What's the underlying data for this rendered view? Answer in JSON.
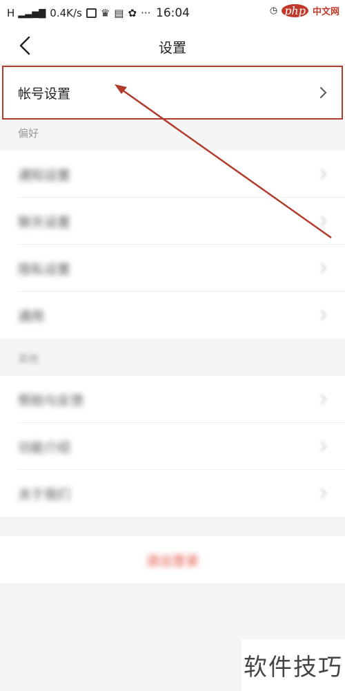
{
  "status_bar": {
    "signal": "H",
    "network_speed": "0.4K/s",
    "time": "16:04",
    "dots": "···",
    "site_logo": "php",
    "site_cn": "中文网"
  },
  "nav": {
    "title": "设置"
  },
  "account_row": {
    "label": "帐号设置"
  },
  "sections": {
    "preferences_title": "偏好",
    "other_title": "其他"
  },
  "preference_items": [
    {
      "label": "通知设置"
    },
    {
      "label": "聊天设置"
    },
    {
      "label": "隐私设置"
    },
    {
      "label": "通用"
    }
  ],
  "other_items": [
    {
      "label": "帮助与反馈"
    },
    {
      "label": "功能介绍"
    },
    {
      "label": "关于我们"
    }
  ],
  "logout": {
    "label": "退出登录"
  },
  "watermark": {
    "text": "软件技巧"
  },
  "colors": {
    "accent_red": "#b23a2a",
    "logout_red": "#e0483a",
    "background": "#f5f5f5"
  }
}
